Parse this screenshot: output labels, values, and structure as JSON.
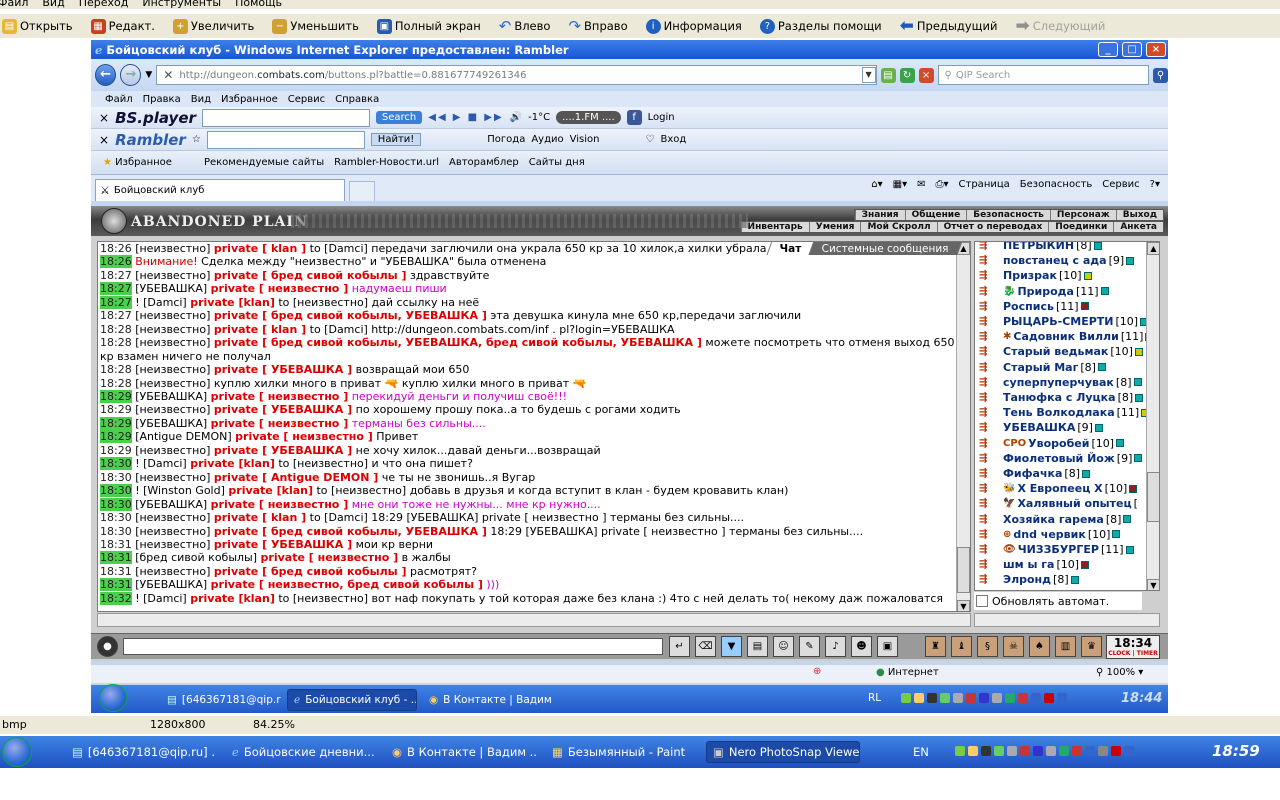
{
  "viewer": {
    "menu": [
      "Файл",
      "Вид",
      "Переход",
      "Инструменты",
      "Помощь"
    ],
    "toolbar": [
      {
        "label": "Открыть",
        "icon": "folder-icon",
        "color": "#e8b830"
      },
      {
        "label": "Редакт.",
        "icon": "edit-icon",
        "color": "#c84020"
      },
      {
        "label": "Увеличить",
        "icon": "zoom-in-icon",
        "color": "#d0a030"
      },
      {
        "label": "Уменьшить",
        "icon": "zoom-out-icon",
        "color": "#d0a030"
      },
      {
        "label": "Полный экран",
        "icon": "fullscreen-icon",
        "color": "#2a5ab0"
      },
      {
        "label": "Влево",
        "icon": "rotate-left-icon",
        "color": "#2a6ad0"
      },
      {
        "label": "Вправо",
        "icon": "rotate-right-icon",
        "color": "#2a6ad0"
      },
      {
        "label": "Информация",
        "icon": "info-icon",
        "color": "#2060c0"
      },
      {
        "label": "Разделы помощи",
        "icon": "help-icon",
        "color": "#2060c0"
      },
      {
        "label": "Предыдущий",
        "icon": "arrow-left-icon",
        "color": "#2058b8"
      },
      {
        "label": "Следующий",
        "icon": "arrow-right-icon",
        "color": "#909090",
        "disabled": true
      }
    ],
    "status": {
      "format": "bmp",
      "dims": "1280x800",
      "zoom": "84.25%"
    }
  },
  "ie": {
    "title": "Бойцовский клуб - Windows Internet Explorer предоставлен: Rambler",
    "address_gray": "http://dungeon.",
    "address_host": "combats.com",
    "address_rest": "/buttons.pl?battle=0.881677749261346",
    "qip_placeholder": "QIP Search",
    "menu": [
      "Файл",
      "Правка",
      "Вид",
      "Избранное",
      "Сервис",
      "Справка"
    ],
    "bsplayer": {
      "brand": "BS.player",
      "search_label": "Search",
      "temp": "-1°C",
      "radio": "....1.FM ....",
      "login": "Login"
    },
    "rambler": {
      "brand": "Rambler",
      "find": "Найти!",
      "items": [
        "Погода",
        "Аудио",
        "Vision",
        "Вход"
      ]
    },
    "favorites": {
      "label": "Избранное",
      "items": [
        "Рекомендуемые сайты",
        "Rambler-Новости.url",
        "Автоpамблер",
        "Сайты дня"
      ]
    },
    "tab": "Бойцовский клуб",
    "commands": [
      "Страница",
      "Безопасность",
      "Сервис"
    ],
    "status": {
      "zone": "Интернет",
      "zoom": "100%"
    }
  },
  "game": {
    "logo": "ABANDONED PLAIN",
    "nav_top": [
      "Знания",
      "Общение",
      "Безопасность",
      "Персонаж",
      "Выход"
    ],
    "nav_bottom": [
      "Инвентарь",
      "Умения",
      "Мой Скролл",
      "Отчет о переводах",
      "Поединки",
      "Анкета"
    ],
    "chat_tabs": [
      "Чат",
      "Системные сообщения"
    ],
    "chat": [
      {
        "t": "18:26",
        "g": false,
        "p": [
          {
            "c": "sn",
            "v": "[неизвестно] "
          },
          {
            "c": "prv",
            "v": "private [ klan ]"
          },
          {
            "c": "txt",
            "v": " to [Damci] передачи заглючили она украла 650 кр за 10 хилок,а хилки убрала"
          }
        ]
      },
      {
        "t": "18:26",
        "g": true,
        "p": [
          {
            "c": "sys",
            "v": "Внимание! "
          },
          {
            "c": "txt",
            "v": "Сделка между \"неизвестно\" и \"УБЕВАШКА\" была отменена"
          }
        ]
      },
      {
        "t": "18:27",
        "g": false,
        "p": [
          {
            "c": "sn",
            "v": "[неизвестно] "
          },
          {
            "c": "prv",
            "v": "private [ бред сивой кобылы ]"
          },
          {
            "c": "txt",
            "v": " здравствуйте"
          }
        ]
      },
      {
        "t": "18:27",
        "g": true,
        "p": [
          {
            "c": "sn",
            "v": "[УБЕВАШКА] "
          },
          {
            "c": "prv",
            "v": "private [ неизвестно ]"
          },
          {
            "c": "txt pk",
            "v": " надумаеш пиши"
          }
        ]
      },
      {
        "t": "18:27",
        "g": true,
        "p": [
          {
            "c": "sn",
            "v": "! [Damci] "
          },
          {
            "c": "prv",
            "v": "private [klan]"
          },
          {
            "c": "txt",
            "v": " to [неизвестно] дай ссылку на неё"
          }
        ]
      },
      {
        "t": "18:27",
        "g": false,
        "p": [
          {
            "c": "sn",
            "v": "[неизвестно] "
          },
          {
            "c": "prv",
            "v": "private [ бред сивой кобылы, УБЕВАШКА ]"
          },
          {
            "c": "txt",
            "v": " эта девушка кинула мне 650 кр,передачи заглючили"
          }
        ]
      },
      {
        "t": "18:28",
        "g": false,
        "p": [
          {
            "c": "sn",
            "v": "[неизвестно] "
          },
          {
            "c": "prv",
            "v": "private [ klan ]"
          },
          {
            "c": "txt",
            "v": " to [Damci] http://dungeon.combats.com/inf . pl?login=УБЕВАШКА"
          }
        ]
      },
      {
        "t": "18:28",
        "g": false,
        "wrap": true,
        "p": [
          {
            "c": "sn",
            "v": "[неизвестно] "
          },
          {
            "c": "prv",
            "v": "private [ бред сивой кобылы, УБЕВАШКА, бред сивой кобылы, УБЕВАШКА ]"
          },
          {
            "c": "txt",
            "v": " можете посмотреть что отменя выход 650 кр взамен ничего не получал"
          }
        ]
      },
      {
        "t": "18:28",
        "g": false,
        "p": [
          {
            "c": "sn",
            "v": "[неизвестно] "
          },
          {
            "c": "prv",
            "v": "private [ УБЕВАШКА ]"
          },
          {
            "c": "txt",
            "v": " возвращай мои 650"
          }
        ]
      },
      {
        "t": "18:28",
        "g": false,
        "p": [
          {
            "c": "sn",
            "v": "[неизвестно] "
          },
          {
            "c": "txt",
            "v": "куплю хилки много в приват 🔫 куплю хилки много в приват 🔫"
          }
        ]
      },
      {
        "t": "18:29",
        "g": true,
        "p": [
          {
            "c": "sn",
            "v": "[УБЕВАШКА] "
          },
          {
            "c": "prv",
            "v": "private [ неизвестно ]"
          },
          {
            "c": "txt pk",
            "v": " перекидуй деньги и получиш своё!!!"
          }
        ]
      },
      {
        "t": "18:29",
        "g": false,
        "p": [
          {
            "c": "sn",
            "v": "[неизвестно] "
          },
          {
            "c": "prv",
            "v": "private [ УБЕВАШКА ]"
          },
          {
            "c": "txt",
            "v": " по хорошему прошу пока..а то будешь с рогами ходить"
          }
        ]
      },
      {
        "t": "18:29",
        "g": true,
        "p": [
          {
            "c": "sn",
            "v": "[УБЕВАШКА] "
          },
          {
            "c": "prv",
            "v": "private [ неизвестно ]"
          },
          {
            "c": "txt pk",
            "v": " терманы без сильны...."
          }
        ]
      },
      {
        "t": "18:29",
        "g": true,
        "p": [
          {
            "c": "sn",
            "v": "[Antigue DEMON] "
          },
          {
            "c": "prv",
            "v": "private [ неизвестно ]"
          },
          {
            "c": "txt",
            "v": " Привет"
          }
        ]
      },
      {
        "t": "18:29",
        "g": false,
        "p": [
          {
            "c": "sn",
            "v": "[неизвестно] "
          },
          {
            "c": "prv",
            "v": "private [ УБЕВАШКА ]"
          },
          {
            "c": "txt",
            "v": " не хочу хилок...давай деньги...возвращай"
          }
        ]
      },
      {
        "t": "18:30",
        "g": true,
        "p": [
          {
            "c": "sn",
            "v": "! [Damci] "
          },
          {
            "c": "prv",
            "v": "private [klan]"
          },
          {
            "c": "txt",
            "v": " to [неизвестно] и что она пишет?"
          }
        ]
      },
      {
        "t": "18:30",
        "g": false,
        "p": [
          {
            "c": "sn",
            "v": "[неизвестно] "
          },
          {
            "c": "prv",
            "v": "private [ Antigue DEMON ]"
          },
          {
            "c": "txt",
            "v": " че ты не звонишь..я Вугар"
          }
        ]
      },
      {
        "t": "18:30",
        "g": true,
        "p": [
          {
            "c": "sn",
            "v": "! [Winston Gold] "
          },
          {
            "c": "prv",
            "v": "private [klan]"
          },
          {
            "c": "txt",
            "v": " to [неизвестно] добавь в друзья и когда вступит в клан - будем кровавить клан)"
          }
        ]
      },
      {
        "t": "18:30",
        "g": true,
        "p": [
          {
            "c": "sn",
            "v": "[УБЕВАШКА] "
          },
          {
            "c": "prv",
            "v": "private [ неизвестно ]"
          },
          {
            "c": "txt pk",
            "v": " мне они тоже не нужны... мне кр нужно...."
          }
        ]
      },
      {
        "t": "18:30",
        "g": false,
        "p": [
          {
            "c": "sn",
            "v": "[неизвестно] "
          },
          {
            "c": "prv",
            "v": "private [ klan ]"
          },
          {
            "c": "txt",
            "v": " to [Damci] 18:29 [УБЕВАШКА] private [ неизвестно ] терманы без сильны...."
          }
        ]
      },
      {
        "t": "18:30",
        "g": false,
        "p": [
          {
            "c": "sn",
            "v": "[неизвестно] "
          },
          {
            "c": "prv",
            "v": "private [ бред сивой кобылы, УБЕВАШКА ]"
          },
          {
            "c": "txt",
            "v": " 18:29 [УБЕВАШКА] private [ неизвестно ] терманы без сильны...."
          }
        ]
      },
      {
        "t": "18:31",
        "g": false,
        "p": [
          {
            "c": "sn",
            "v": "[неизвестно] "
          },
          {
            "c": "prv",
            "v": "private [ УБЕВАШКА ]"
          },
          {
            "c": "txt",
            "v": " мои кр верни"
          }
        ]
      },
      {
        "t": "18:31",
        "g": true,
        "p": [
          {
            "c": "sn",
            "v": "[бред сивой кобылы] "
          },
          {
            "c": "prv",
            "v": "private [ неизвестно ]"
          },
          {
            "c": "txt",
            "v": " в жалбы"
          }
        ]
      },
      {
        "t": "18:31",
        "g": false,
        "p": [
          {
            "c": "sn",
            "v": "[неизвестно] "
          },
          {
            "c": "prv",
            "v": "private [ бред сивой кобылы ]"
          },
          {
            "c": "txt",
            "v": " расмотрят?"
          }
        ]
      },
      {
        "t": "18:31",
        "g": true,
        "p": [
          {
            "c": "sn",
            "v": "[УБЕВАШКА] "
          },
          {
            "c": "prv",
            "v": "private [ неизвестно, бред сивой кобылы ]"
          },
          {
            "c": "txt pk",
            "v": " )))"
          }
        ]
      },
      {
        "t": "18:32",
        "g": true,
        "p": [
          {
            "c": "sn",
            "v": "! [Damci] "
          },
          {
            "c": "prv",
            "v": "private [klan]"
          },
          {
            "c": "txt",
            "v": " to [неизвестно] вот наф покупать у той которая даже без клана :) 4то с ней делать то( некому даж пожаловатся"
          }
        ]
      }
    ],
    "users": [
      {
        "name": "ПЕТРЫКИН",
        "level": "[8]",
        "badge": "teal"
      },
      {
        "name": "повстанец с ада",
        "level": "[9]",
        "badge": "teal"
      },
      {
        "name": "Призрак",
        "level": "[10]",
        "badge": "yellow"
      },
      {
        "name": "Природа",
        "level": "[11]",
        "badge": "teal",
        "emblem": "🐉"
      },
      {
        "name": "Роспись",
        "level": "[11]",
        "badge": "dark"
      },
      {
        "name": "РЫЦАРЬ-СМЕРТИ",
        "level": "[10]",
        "badge": "teal"
      },
      {
        "name": "Садовник Вилли",
        "level": "[11]",
        "badge": "teal",
        "emblem": "✱"
      },
      {
        "name": "Старый ведьмак",
        "level": "[10]",
        "badge": "yellow"
      },
      {
        "name": "Старый Маг",
        "level": "[8]",
        "badge": "teal"
      },
      {
        "name": "суперпуперчувак",
        "level": "[8]",
        "badge": "teal"
      },
      {
        "name": "Танюфка с Луцка",
        "level": "[8]",
        "badge": "teal"
      },
      {
        "name": "Тень Волкодлака",
        "level": "[11]",
        "badge": "yellow"
      },
      {
        "name": "УБЕВАШКА",
        "level": "[9]",
        "badge": "teal"
      },
      {
        "name": "Уворобей",
        "level": "[10]",
        "badge": "teal",
        "emblem": "CPO"
      },
      {
        "name": "Фиолетовый Йож",
        "level": "[9]",
        "badge": "teal"
      },
      {
        "name": "Фифачка",
        "level": "[8]",
        "badge": "teal"
      },
      {
        "name": "X Европеец X",
        "level": "[10]",
        "badge": "dark",
        "emblem": "🐝"
      },
      {
        "name": "Халявный опытец",
        "level": "[",
        "badge": "",
        "emblem": "🦅"
      },
      {
        "name": "Хозяйка гарема",
        "level": "[8]",
        "badge": "teal"
      },
      {
        "name": "dnd червик",
        "level": "[10]",
        "badge": "teal",
        "emblem": "⊕"
      },
      {
        "name": "ЧИЗЗБУРГЕР",
        "level": "[11]",
        "badge": "teal",
        "emblem": "👁"
      },
      {
        "name": "шм ы га",
        "level": "[10]",
        "badge": "dark"
      },
      {
        "name": "Элронд",
        "level": "[8]",
        "badge": "teal"
      }
    ],
    "auto_refresh": "Обновлять автомат.",
    "clock": "18:34",
    "clock_sub": "CLOCK | TIMER"
  },
  "taskbar_inner": {
    "tasks": [
      "[646367181@qip.ru] ...",
      "Бойцовский клуб - ...",
      "В Контакте | Вадим ..."
    ],
    "lang": "RL",
    "time": "18:44"
  },
  "taskbar_outer": {
    "tasks": [
      "[646367181@qip.ru] ...",
      "Бойцовские дневни...",
      "В Контакте | Вадим ...",
      "Безымянный - Paint",
      "Nero PhotoSnap Viewer"
    ],
    "lang": "EN",
    "time": "18:59"
  },
  "colors": {
    "private": "#dd0000",
    "pink": "#cc00cc",
    "green_time": "#4ccf4c",
    "user_name": "#0a2f7a",
    "xp_blue": "#2459c9"
  }
}
